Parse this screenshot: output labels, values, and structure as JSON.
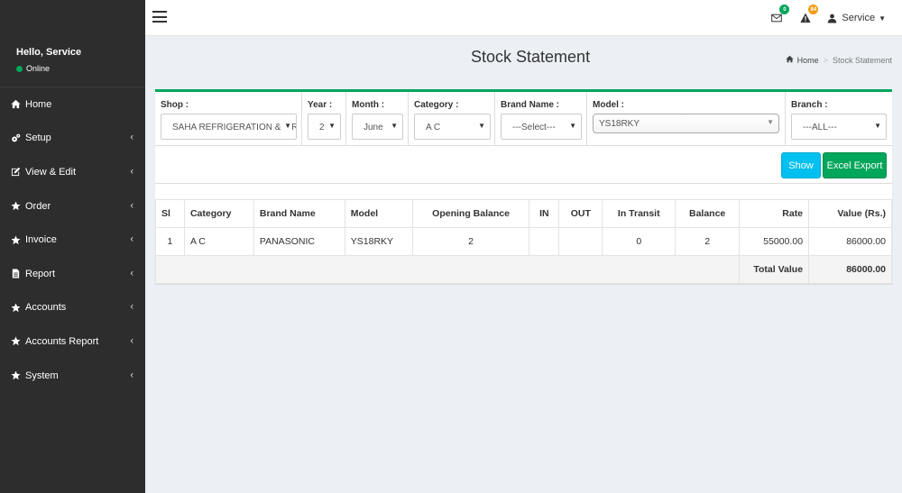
{
  "sidebar": {
    "greeting": "Hello, Service",
    "status": "Online",
    "status_color": "#00a65a",
    "items": [
      {
        "label": "Home",
        "icon": "home-icon",
        "has_submenu": false
      },
      {
        "label": "Setup",
        "icon": "cogs-icon",
        "has_submenu": true
      },
      {
        "label": "View & Edit",
        "icon": "edit-icon",
        "has_submenu": true
      },
      {
        "label": "Order",
        "icon": "star-icon",
        "has_submenu": true
      },
      {
        "label": "Invoice",
        "icon": "star-icon",
        "has_submenu": true
      },
      {
        "label": "Report",
        "icon": "file-icon",
        "has_submenu": true
      },
      {
        "label": "Accounts",
        "icon": "star-icon",
        "has_submenu": true
      },
      {
        "label": "Accounts Report",
        "icon": "star-icon",
        "has_submenu": true
      },
      {
        "label": "System",
        "icon": "star-icon",
        "has_submenu": true
      }
    ]
  },
  "topbar": {
    "messages_count": "0",
    "alerts_count": "84",
    "user_label": "Service"
  },
  "header": {
    "title": "Stock Statement",
    "breadcrumb_home": "Home",
    "breadcrumb_current": "Stock Statement"
  },
  "filters": {
    "shop": {
      "label": "Shop :",
      "value": "SAHA REFRIGERATION & AIR"
    },
    "year": {
      "label": "Year :",
      "value": "2"
    },
    "month": {
      "label": "Month :",
      "value": "June"
    },
    "category": {
      "label": "Category :",
      "value": "A C"
    },
    "brand": {
      "label": "Brand Name :",
      "value": "---Select---"
    },
    "model": {
      "label": "Model :",
      "value": "YS18RKY"
    },
    "branch": {
      "label": "Branch :",
      "value": "---ALL---"
    }
  },
  "actions": {
    "show_label": "Show",
    "export_label": "Excel Export"
  },
  "table": {
    "headers": [
      "Sl",
      "Category",
      "Brand Name",
      "Model",
      "Opening Balance",
      "IN",
      "OUT",
      "In Transit",
      "Balance",
      "Rate",
      "Value (Rs.)"
    ],
    "rows": [
      [
        "1",
        "A C",
        "PANASONIC",
        "YS18RKY",
        "2",
        "",
        "",
        "0",
        "2",
        "55000.00",
        "86000.00"
      ]
    ],
    "total_label": "Total Value",
    "total_value": "86000.00"
  },
  "colors": {
    "sidebar_bg": "#2d2d2d",
    "box_accent": "#00a65a",
    "show_button": "#00c0ef",
    "export_button": "#00a65a",
    "badge_orange": "#f39c12"
  }
}
